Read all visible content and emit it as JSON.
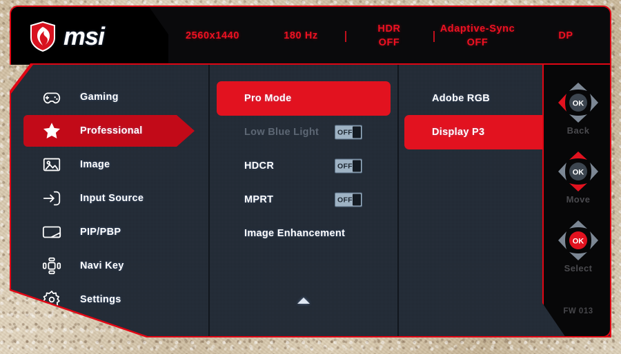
{
  "brand": {
    "logo_icon": "msi-dragon-shield-icon",
    "wordmark": "msi"
  },
  "header": {
    "status": [
      {
        "name": "resolution",
        "line1": "2560x1440",
        "line2": ""
      },
      {
        "name": "refresh-rate",
        "line1": "180 Hz",
        "line2": ""
      },
      {
        "name": "hdr",
        "line1": "HDR",
        "line2": "OFF"
      },
      {
        "name": "adaptive-sync",
        "line1": "Adaptive-Sync",
        "line2": "OFF"
      },
      {
        "name": "input-signal",
        "line1": "DP",
        "line2": ""
      }
    ]
  },
  "sidebar": {
    "items": [
      {
        "label": "Gaming",
        "icon": "gamepad-icon",
        "selected": false
      },
      {
        "label": "Professional",
        "icon": "star-icon",
        "selected": true
      },
      {
        "label": "Image",
        "icon": "picture-icon",
        "selected": false
      },
      {
        "label": "Input Source",
        "icon": "input-arrow-icon",
        "selected": false
      },
      {
        "label": "PIP/PBP",
        "icon": "pip-pbp-icon",
        "selected": false
      },
      {
        "label": "Navi Key",
        "icon": "navi-key-icon",
        "selected": false
      },
      {
        "label": "Settings",
        "icon": "gear-icon",
        "selected": false
      }
    ]
  },
  "options": {
    "items": [
      {
        "label": "Pro Mode",
        "selected": true,
        "disabled": false,
        "toggle": null
      },
      {
        "label": "Low Blue Light",
        "selected": false,
        "disabled": true,
        "toggle": "OFF"
      },
      {
        "label": "HDCR",
        "selected": false,
        "disabled": false,
        "toggle": "OFF"
      },
      {
        "label": "MPRT",
        "selected": false,
        "disabled": false,
        "toggle": "OFF"
      },
      {
        "label": "Image Enhancement",
        "selected": false,
        "disabled": false,
        "toggle": null
      }
    ],
    "scroll_up_icon": "triangle-up-icon"
  },
  "values": {
    "items": [
      {
        "label": "Adobe RGB",
        "selected": false
      },
      {
        "label": "Display P3",
        "selected": true
      }
    ]
  },
  "nav_help": {
    "groups": [
      {
        "caption": "Back",
        "highlight": "left"
      },
      {
        "caption": "Move",
        "highlight": "up-down"
      },
      {
        "caption": "Select",
        "highlight": "center"
      }
    ],
    "center_label": "OK",
    "firmware": "FW 013"
  },
  "colors": {
    "accent_red": "#e10614",
    "highlight_red": "#e2121f",
    "sidebar_red": "#c20a18",
    "panel_navy": "#222b36",
    "header_black": "#0a0a0c",
    "toggle_body": "#9fb3c4",
    "disabled_text": "#5d6774"
  }
}
